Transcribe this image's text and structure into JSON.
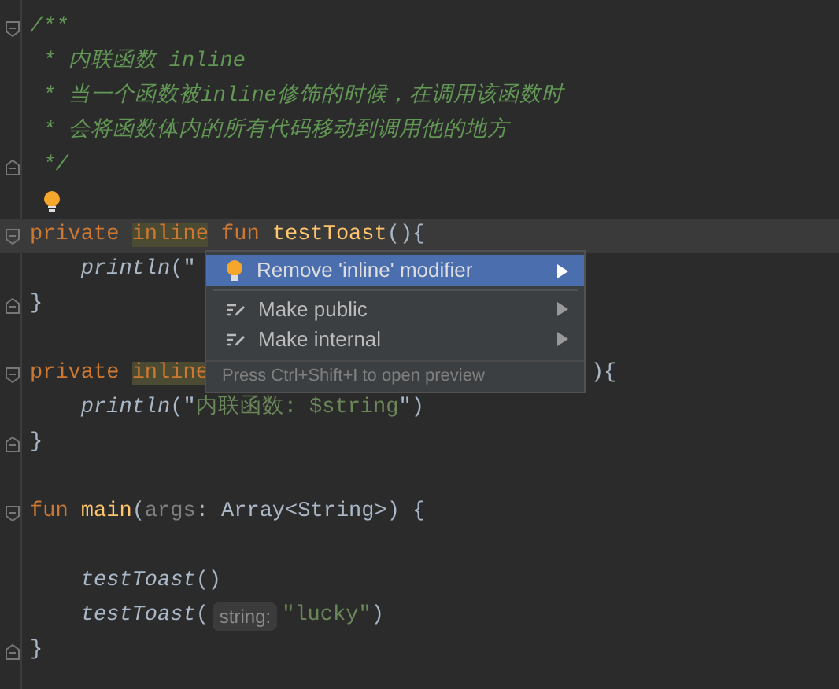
{
  "editor": {
    "lines": [
      {
        "kind": "code",
        "fold_start": true,
        "tokens": [
          {
            "kind": "comment",
            "text": "/**"
          }
        ]
      },
      {
        "kind": "code",
        "tokens": [
          {
            "kind": "comment",
            "text": " * 内联函数 inline"
          }
        ]
      },
      {
        "kind": "code",
        "tokens": [
          {
            "kind": "comment",
            "text": " * 当一个函数被inline修饰的时候，在调用该函数时"
          }
        ]
      },
      {
        "kind": "code",
        "tokens": [
          {
            "kind": "comment",
            "text": " * 会将函数体内的所有代码移动到调用他的地方"
          }
        ]
      },
      {
        "kind": "code",
        "fold_end": true,
        "tokens": [
          {
            "kind": "comment",
            "text": " */"
          }
        ]
      },
      {
        "kind": "bulb"
      },
      {
        "kind": "code",
        "fold_start": true,
        "current": true,
        "tokens": [
          {
            "kind": "keyword",
            "text": "private "
          },
          {
            "kind": "keyword",
            "text": "inline",
            "highlighted": true
          },
          {
            "kind": "keyword",
            "text": " fun "
          },
          {
            "kind": "declaration",
            "text": "testToast"
          },
          {
            "kind": "plain",
            "text": "(){"
          }
        ],
        "children": [
          {
            "kind": "code",
            "tokens": [
              {
                "kind": "call",
                "text": "println"
              },
              {
                "kind": "plain",
                "text": "(\""
              },
              {
                "kind": "covered"
              }
            ]
          }
        ]
      },
      {
        "kind": "code",
        "fold_end": true,
        "tokens": [
          {
            "kind": "plain",
            "text": "}"
          }
        ]
      },
      {
        "kind": "blank"
      },
      {
        "kind": "code",
        "fold_start": true,
        "tokens": [
          {
            "kind": "keyword",
            "text": "private "
          },
          {
            "kind": "keyword",
            "text": "inline",
            "highlighted": true
          },
          {
            "kind": "covered"
          },
          {
            "kind": "plain",
            "text": "){"
          }
        ],
        "children": [
          {
            "kind": "code",
            "tokens": [
              {
                "kind": "call",
                "text": "println"
              },
              {
                "kind": "plain",
                "text": "(\""
              },
              {
                "kind": "string",
                "text": "内联函数: $string"
              },
              {
                "kind": "plain",
                "text": "\")"
              }
            ]
          }
        ]
      },
      {
        "kind": "code",
        "fold_end": true,
        "tokens": [
          {
            "kind": "plain",
            "text": "}"
          }
        ]
      },
      {
        "kind": "blank"
      },
      {
        "kind": "code",
        "fold_start": true,
        "tokens": [
          {
            "kind": "keyword",
            "text": "fun "
          },
          {
            "kind": "declaration",
            "text": "main"
          },
          {
            "kind": "plain",
            "text": "("
          },
          {
            "kind": "param",
            "text": "args"
          },
          {
            "kind": "plain",
            "text": ": Array<String>) {"
          }
        ],
        "children": [
          {
            "kind": "blank"
          },
          {
            "kind": "code",
            "tokens": [
              {
                "kind": "call",
                "text": "testToast"
              },
              {
                "kind": "plain",
                "text": "()"
              }
            ]
          },
          {
            "kind": "code",
            "tokens": [
              {
                "kind": "call",
                "text": "testToast"
              },
              {
                "kind": "plain",
                "text": "("
              },
              {
                "kind": "hint",
                "text": "string:"
              },
              {
                "kind": "string",
                "text": "\"lucky\""
              },
              {
                "kind": "plain",
                "text": ")"
              }
            ]
          }
        ]
      },
      {
        "kind": "code",
        "fold_end": true,
        "tokens": [
          {
            "kind": "plain",
            "text": "}"
          }
        ]
      }
    ]
  },
  "popup": {
    "items": [
      {
        "kind": "quickfix",
        "label": "Remove 'inline' modifier",
        "selected": true
      },
      {
        "kind": "intention",
        "label": "Make public",
        "selected": false
      },
      {
        "kind": "intention",
        "label": "Make internal",
        "selected": false
      }
    ],
    "footer": "Press Ctrl+Shift+I to open preview"
  }
}
